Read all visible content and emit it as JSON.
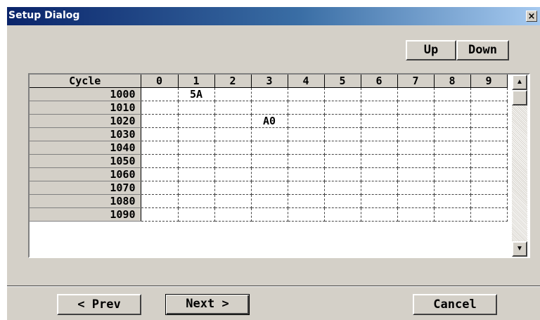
{
  "window": {
    "title": "Setup Dialog",
    "close_label": "×"
  },
  "toolbar": {
    "up_label": "Up",
    "down_label": "Down"
  },
  "grid": {
    "corner_header": "Cycle",
    "columns": [
      "0",
      "1",
      "2",
      "3",
      "4",
      "5",
      "6",
      "7",
      "8",
      "9"
    ],
    "rows": [
      {
        "cycle": "1000",
        "cells": [
          "",
          "5A",
          "",
          "",
          "",
          "",
          "",
          "",
          "",
          ""
        ]
      },
      {
        "cycle": "1010",
        "cells": [
          "",
          "",
          "",
          "",
          "",
          "",
          "",
          "",
          "",
          ""
        ]
      },
      {
        "cycle": "1020",
        "cells": [
          "",
          "",
          "",
          "A0",
          "",
          "",
          "",
          "",
          "",
          ""
        ]
      },
      {
        "cycle": "1030",
        "cells": [
          "",
          "",
          "",
          "",
          "",
          "",
          "",
          "",
          "",
          ""
        ]
      },
      {
        "cycle": "1040",
        "cells": [
          "",
          "",
          "",
          "",
          "",
          "",
          "",
          "",
          "",
          ""
        ]
      },
      {
        "cycle": "1050",
        "cells": [
          "",
          "",
          "",
          "",
          "",
          "",
          "",
          "",
          "",
          ""
        ]
      },
      {
        "cycle": "1060",
        "cells": [
          "",
          "",
          "",
          "",
          "",
          "",
          "",
          "",
          "",
          ""
        ]
      },
      {
        "cycle": "1070",
        "cells": [
          "",
          "",
          "",
          "",
          "",
          "",
          "",
          "",
          "",
          ""
        ]
      },
      {
        "cycle": "1080",
        "cells": [
          "",
          "",
          "",
          "",
          "",
          "",
          "",
          "",
          "",
          ""
        ]
      },
      {
        "cycle": "1090",
        "cells": [
          "",
          "",
          "",
          "",
          "",
          "",
          "",
          "",
          "",
          ""
        ]
      }
    ]
  },
  "scrollbar": {
    "up_icon": "triangle-up-icon",
    "down_icon": "triangle-down-icon",
    "up_glyph": "▲",
    "down_glyph": "▼"
  },
  "footer": {
    "prev_label": "< Prev",
    "next_label": "Next >",
    "cancel_label": "Cancel"
  }
}
